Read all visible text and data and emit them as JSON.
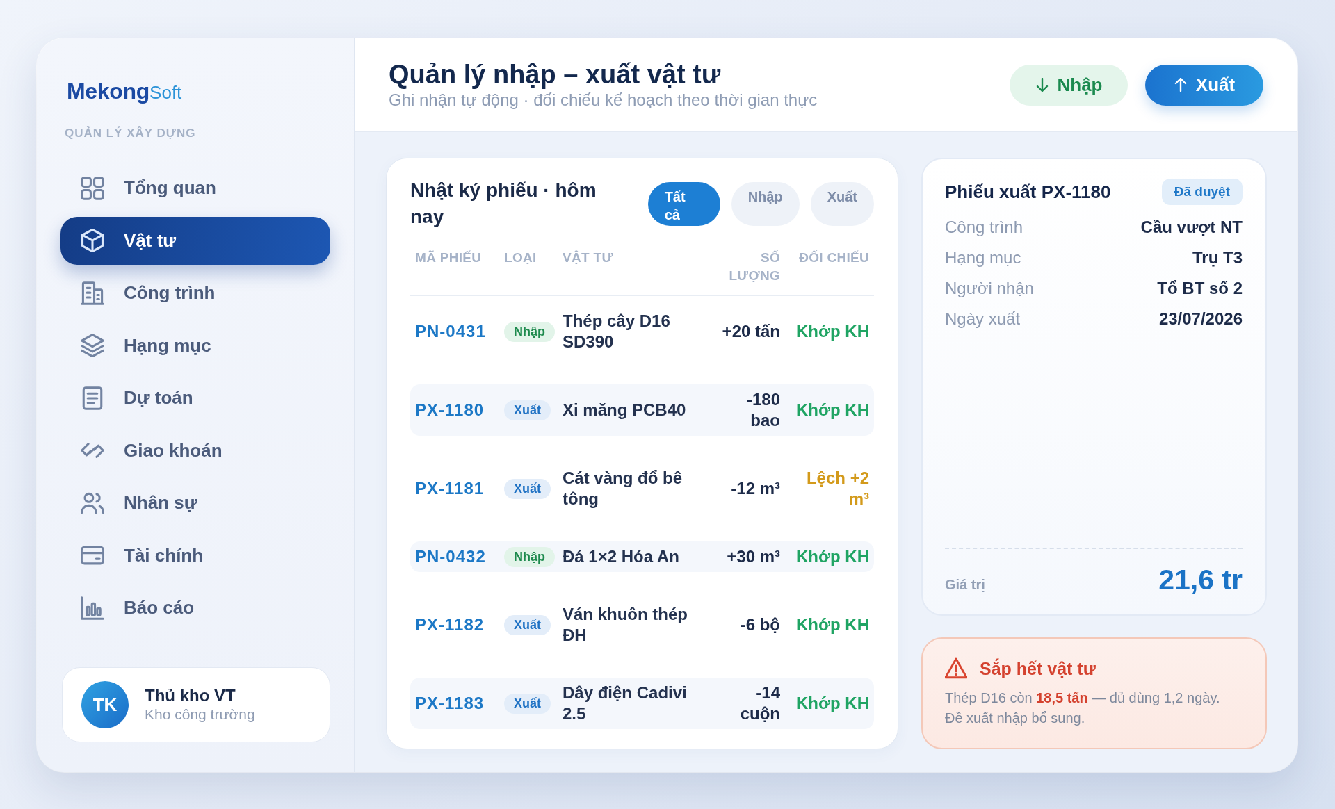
{
  "sidebar": {
    "logo": {
      "primary": "Mekong",
      "secondary": "Soft"
    },
    "section_label": "QUẢN LÝ XÂY DỰNG",
    "items": [
      {
        "label": "Tổng quan",
        "selected": false
      },
      {
        "label": "Vật tư",
        "selected": true
      },
      {
        "label": "Công trình",
        "selected": false
      },
      {
        "label": "Hạng mục",
        "selected": false
      },
      {
        "label": "Dự toán",
        "selected": false
      },
      {
        "label": "Giao khoán",
        "selected": false
      },
      {
        "label": "Nhân sự",
        "selected": false
      },
      {
        "label": "Tài chính",
        "selected": false
      },
      {
        "label": "Báo cáo",
        "selected": false
      }
    ],
    "user": {
      "initials": "TK",
      "name": "Thủ kho VT",
      "role": "Kho công trường"
    }
  },
  "header": {
    "title": "Quản lý nhập – xuất vật tư",
    "subtitle": "Ghi nhận tự động · đối chiếu kế hoạch theo thời gian thực",
    "actions": [
      {
        "label": "Nhập",
        "kind": "import"
      },
      {
        "label": "Xuất",
        "kind": "export"
      }
    ]
  },
  "log": {
    "title": "Nhật ký phiếu · hôm nay",
    "filters": [
      {
        "label": "Tất cả",
        "selected": true
      },
      {
        "label": "Nhập",
        "selected": false
      },
      {
        "label": "Xuất",
        "selected": false
      }
    ],
    "columns": [
      "MÃ PHIẾU",
      "LOẠI",
      "VẬT TƯ",
      "SỐ LƯỢNG",
      "ĐỐI CHIẾU"
    ],
    "rows": [
      {
        "code": "PN-0431",
        "type": "Nhập",
        "kind": "import",
        "material": "Thép cây D16 SD390",
        "quantity": "+20 tấn",
        "reconciliation": "Khớp KH",
        "deviation": false
      },
      {
        "code": "PX-1180",
        "type": "Xuất",
        "kind": "export",
        "material": "Xi măng PCB40",
        "quantity": "-180 bao",
        "reconciliation": "Khớp KH",
        "deviation": false
      },
      {
        "code": "PX-1181",
        "type": "Xuất",
        "kind": "export",
        "material": "Cát vàng đổ bê tông",
        "quantity": "-12 m³",
        "reconciliation": "Lệch +2 m³",
        "deviation": true
      },
      {
        "code": "PN-0432",
        "type": "Nhập",
        "kind": "import",
        "material": "Đá 1×2 Hóa An",
        "quantity": "+30 m³",
        "reconciliation": "Khớp KH",
        "deviation": false
      },
      {
        "code": "PX-1182",
        "type": "Xuất",
        "kind": "export",
        "material": "Ván khuôn thép ĐH",
        "quantity": "-6 bộ",
        "reconciliation": "Khớp KH",
        "deviation": false
      },
      {
        "code": "PX-1183",
        "type": "Xuất",
        "kind": "export",
        "material": "Dây điện Cadivi 2.5",
        "quantity": "-14 cuộn",
        "reconciliation": "Khớp KH",
        "deviation": false
      }
    ]
  },
  "detail": {
    "title": "Phiếu xuất PX-1180",
    "badge": "Đã duyệt",
    "fields": [
      {
        "label": "Công trình",
        "value": "Cầu vượt NT"
      },
      {
        "label": "Hạng mục",
        "value": "Trụ T3"
      },
      {
        "label": "Người nhận",
        "value": "Tổ BT số 2"
      },
      {
        "label": "Ngày xuất",
        "value": "23/07/2026"
      }
    ],
    "total": {
      "label": "Giá trị",
      "value": "21,6 tr"
    }
  },
  "alert": {
    "title": "Sắp hết vật tư",
    "message": "Thép D16 còn **18,5 tấn** — đủ dùng 1,2 ngày. Đề xuất nhập bổ sung."
  }
}
